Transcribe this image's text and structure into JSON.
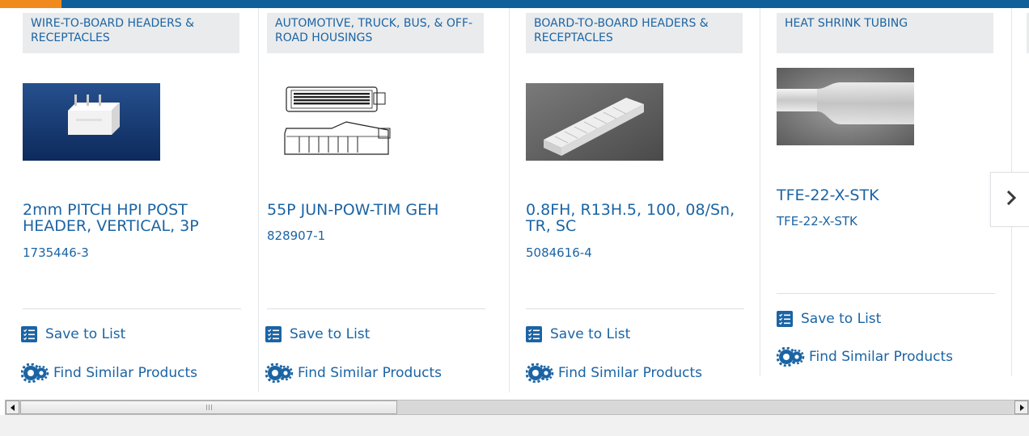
{
  "cards": [
    {
      "category": "WIRE-TO-BOARD HEADERS & RECEPTACLES",
      "title": "2mm PITCH HPI POST HEADER, VERTICAL, 3P",
      "part_number": "1735446-3",
      "save_label": "Save to List",
      "find_label": "Find Similar Products"
    },
    {
      "category": "AUTOMOTIVE, TRUCK, BUS, & OFF-ROAD HOUSINGS",
      "title": "55P JUN-POW-TIM GEH",
      "part_number": "828907-1",
      "save_label": "Save to List",
      "find_label": "Find Similar Products"
    },
    {
      "category": "BOARD-TO-BOARD HEADERS & RECEPTACLES",
      "title": "0.8FH, R13H.5, 100, 08/Sn, TR, SC",
      "part_number": "5084616-4",
      "save_label": "Save to List",
      "find_label": "Find Similar Products"
    },
    {
      "category": "HEAT SHRINK TUBING",
      "title": "TFE-22-X-STK",
      "part_number": "TFE-22-X-STK",
      "save_label": "Save to List",
      "find_label": "Find Similar Products"
    }
  ],
  "carousel": {
    "next_icon": "chevron-right-icon"
  },
  "colors": {
    "brand_blue": "#0f5f9a",
    "link_blue": "#1b64a4",
    "accent_orange": "#f08a1c"
  }
}
